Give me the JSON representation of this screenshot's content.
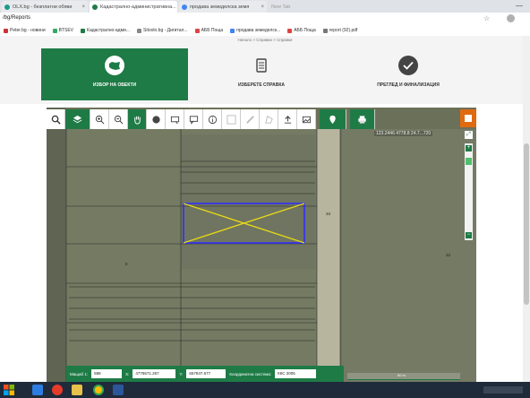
{
  "tabs": [
    {
      "label": "OLX.bg - безплатни обяви",
      "color": "#1a9a8a"
    },
    {
      "label": "Кадастрално-административна...",
      "color": "#1e7b46"
    },
    {
      "label": "продава земеделска земя",
      "color": "#4285f4"
    },
    {
      "label": "New Tab",
      "color": "#999999"
    }
  ],
  "address": {
    "url": "/bg/Reports"
  },
  "bookmarks": [
    "Peter.bg - новини",
    "BTSEV",
    "Кадастрално-адми...",
    "Sitoolo.bg - Дигитал...",
    "АББ Поща",
    "продава земеделск...",
    "АББ Поща",
    "report (92).pdf"
  ],
  "breadcrumb": {
    "text": "Начало > Справки > Справки"
  },
  "steps": [
    {
      "label": "ИЗБОР НА ОБЕКТИ"
    },
    {
      "label": "ИЗБЕРЕТЕ СПРАВКА"
    },
    {
      "label": "ПРЕГЛЕД И ФИНАЛИЗАЦИЯ"
    }
  ],
  "map": {
    "top_right_readout": "123.2446 4778.8 24.7...720",
    "parcel_labels": [
      "33",
      "32",
      "8"
    ]
  },
  "coords": {
    "zoom_label": "Мащаб 1:",
    "zoom": "588",
    "x_label": "X:",
    "x": "4778671.267",
    "y_label": "Y:",
    "y": "657847.677",
    "system_label": "Координатна система:",
    "system": "ККС 2005",
    "scale_text": "50 m"
  },
  "colors": {
    "primary": "#1e7b46",
    "accent": "#e06a10",
    "parcel_outline": "#2b2bff",
    "parcel_diag": "#e4d61a"
  }
}
